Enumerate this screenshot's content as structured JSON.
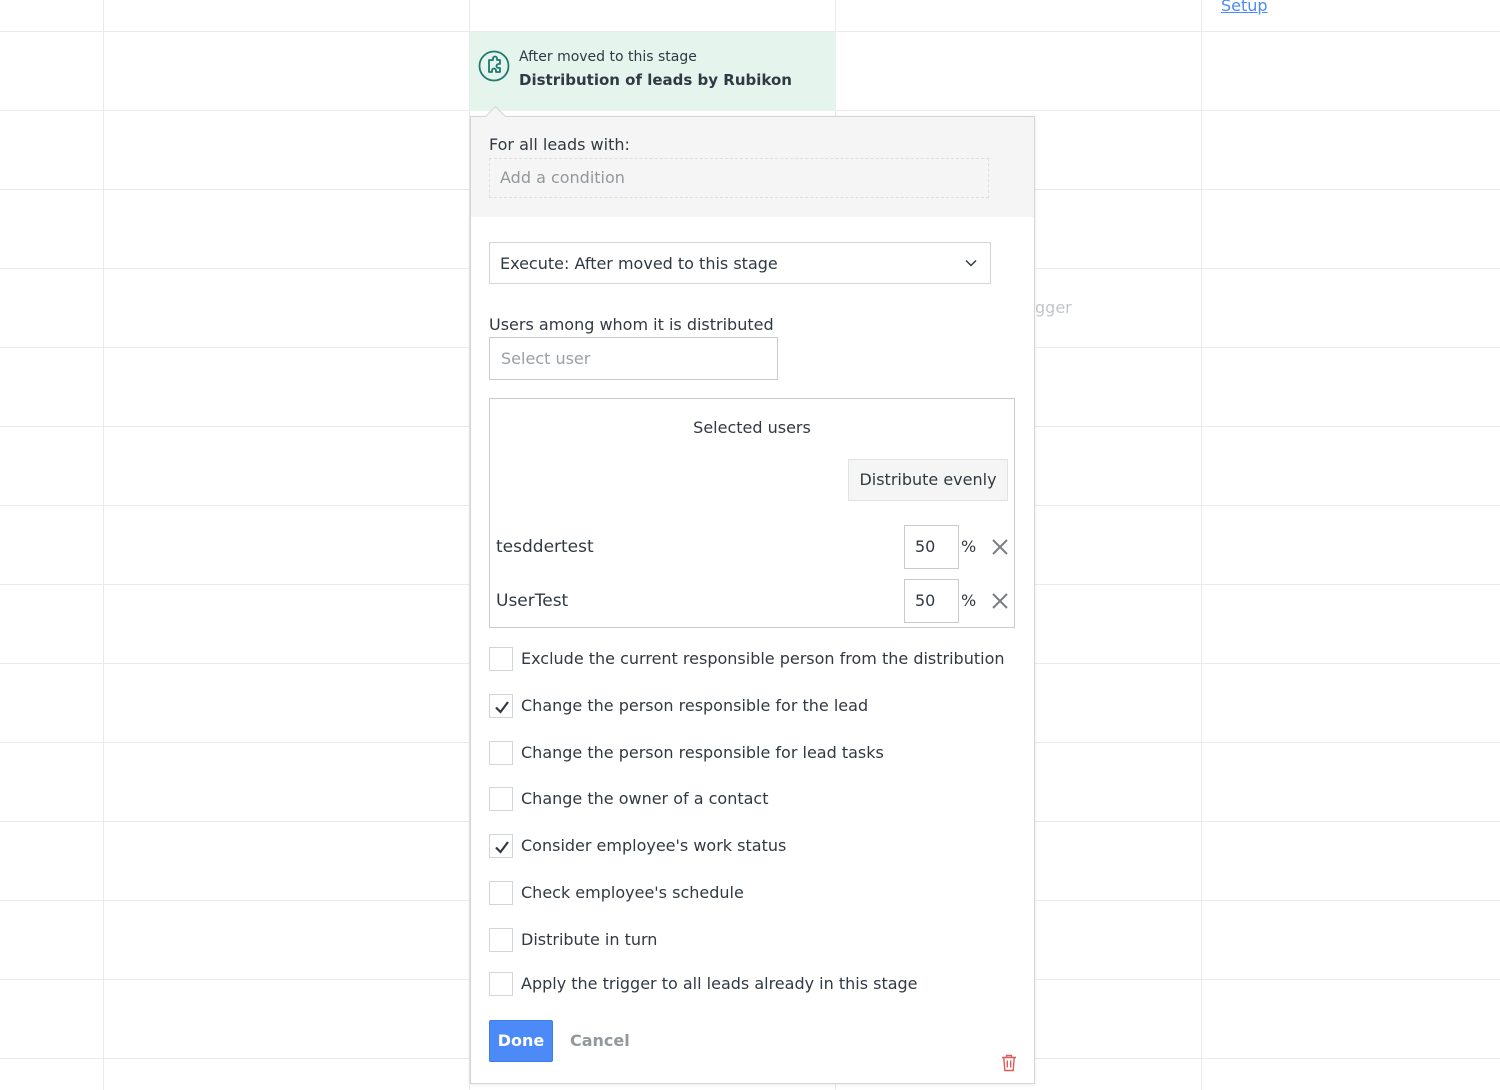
{
  "background": {
    "setup_link": "Setup",
    "trigger_hint": "rigger"
  },
  "trigger_card": {
    "subtitle": "After moved to this stage",
    "title": "Distribution of leads by Rubikon",
    "icon": "puzzle-icon",
    "bg_color": "#e6f4ee",
    "icon_color": "#1f7a6c"
  },
  "modal": {
    "conditions": {
      "label": "For all leads with:",
      "add_condition": "Add a condition"
    },
    "execute": {
      "value": "Execute: After moved to this stage"
    },
    "users": {
      "label": "Users among whom it is distributed",
      "placeholder": "Select user"
    },
    "selected_users": {
      "title": "Selected users",
      "distribute_button": "Distribute evenly",
      "rows": [
        {
          "name": "tesddertest",
          "percent": "50",
          "unit": "%"
        },
        {
          "name": "UserTest",
          "percent": "50",
          "unit": "%"
        }
      ]
    },
    "options": [
      {
        "label": "Exclude the current responsible person from the distribution",
        "checked": false
      },
      {
        "label": "Change the person responsible for the lead",
        "checked": true
      },
      {
        "label": "Change the person responsible for lead tasks",
        "checked": false
      },
      {
        "label": "Change the owner of a contact",
        "checked": false
      },
      {
        "label": "Consider employee's work status",
        "checked": true
      },
      {
        "label": "Check employee's schedule",
        "checked": false
      },
      {
        "label": "Distribute in turn",
        "checked": false
      },
      {
        "label": "Apply the trigger to all leads already in this stage",
        "checked": false
      }
    ],
    "footer": {
      "done": "Done",
      "cancel": "Cancel",
      "delete_icon": "trash-icon"
    }
  },
  "colors": {
    "primary": "#4c8bf7",
    "delete": "#e05a5a"
  }
}
